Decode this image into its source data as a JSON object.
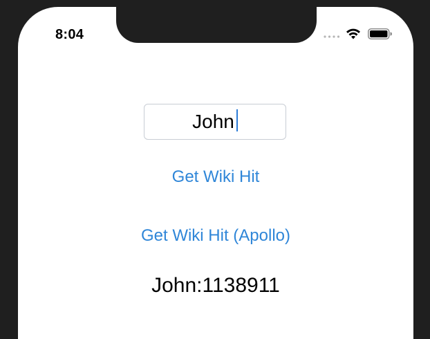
{
  "status_bar": {
    "time": "8:04",
    "icons": [
      "cellular-signal-icon",
      "wifi-icon",
      "battery-icon"
    ]
  },
  "form": {
    "name_value": "John"
  },
  "buttons": {
    "get_wiki_hit": "Get Wiki Hit",
    "get_wiki_hit_apollo": "Get Wiki Hit (Apollo)"
  },
  "result": {
    "text": "John:1138911"
  },
  "colors": {
    "link": "#2f86d8",
    "caret": "#2b7bd6",
    "bezel": "#1f1f1f"
  }
}
